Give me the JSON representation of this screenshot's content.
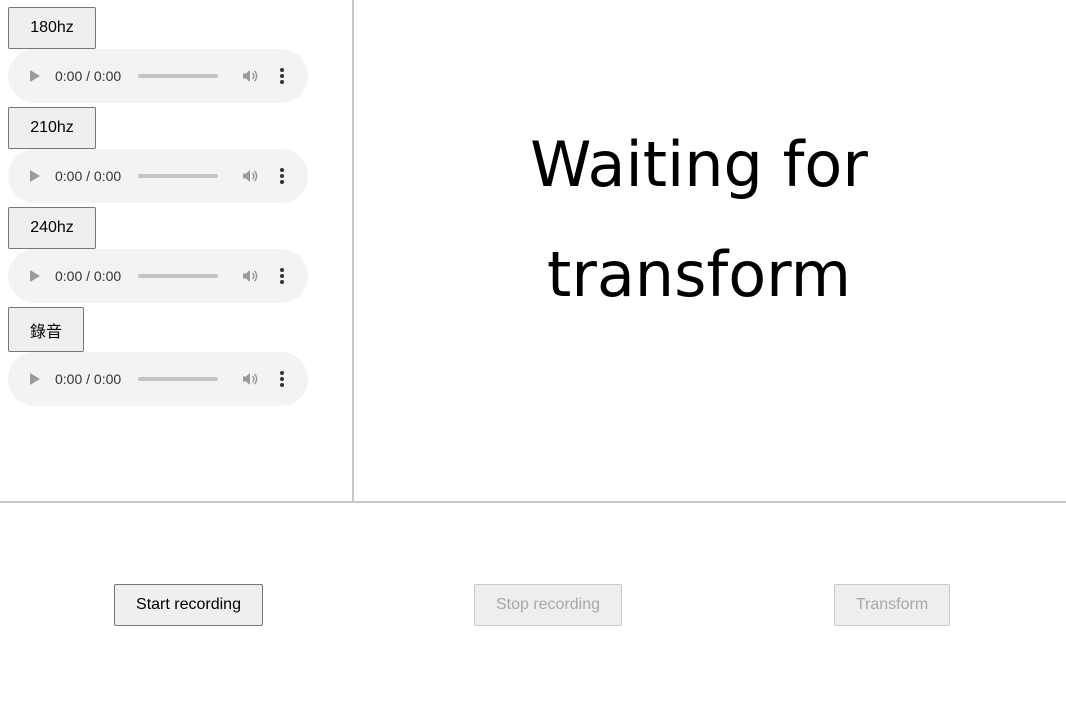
{
  "sounds": [
    {
      "button_label": "180hz",
      "time": "0:00 / 0:00"
    },
    {
      "button_label": "210hz",
      "time": "0:00 / 0:00"
    },
    {
      "button_label": "240hz",
      "time": "0:00 / 0:00"
    },
    {
      "button_label": "錄音",
      "time": "0:00 / 0:00"
    }
  ],
  "status_text": "Waiting for transform",
  "controls": {
    "start_label": "Start recording",
    "stop_label": "Stop recording",
    "transform_label": "Transform"
  }
}
